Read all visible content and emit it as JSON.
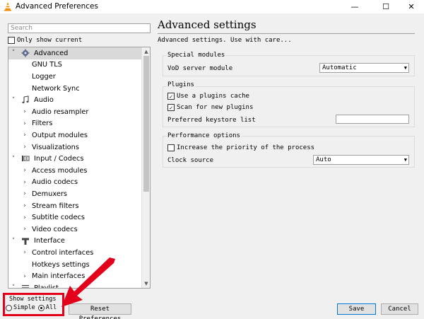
{
  "window": {
    "title": "Advanced Preferences",
    "minimize_glyph": "—",
    "maximize_glyph": "☐",
    "close_glyph": "✕"
  },
  "left": {
    "search_placeholder": "Search",
    "only_show_current": "Only show current",
    "tree": [
      {
        "label": "Advanced",
        "level": 0,
        "expanded": true,
        "icon": "gear-icon",
        "selected": true
      },
      {
        "label": "GNU TLS",
        "level": 1
      },
      {
        "label": "Logger",
        "level": 1
      },
      {
        "label": "Network Sync",
        "level": 1
      },
      {
        "label": "Audio",
        "level": 0,
        "expanded": true,
        "icon": "music-note-icon"
      },
      {
        "label": "Audio resampler",
        "level": 1,
        "has_children": true
      },
      {
        "label": "Filters",
        "level": 1,
        "has_children": true
      },
      {
        "label": "Output modules",
        "level": 1,
        "has_children": true
      },
      {
        "label": "Visualizations",
        "level": 1,
        "has_children": true
      },
      {
        "label": "Input / Codecs",
        "level": 0,
        "expanded": true,
        "icon": "codec-icon"
      },
      {
        "label": "Access modules",
        "level": 1,
        "has_children": true
      },
      {
        "label": "Audio codecs",
        "level": 1,
        "has_children": true
      },
      {
        "label": "Demuxers",
        "level": 1,
        "has_children": true
      },
      {
        "label": "Stream filters",
        "level": 1,
        "has_children": true
      },
      {
        "label": "Subtitle codecs",
        "level": 1,
        "has_children": true
      },
      {
        "label": "Video codecs",
        "level": 1,
        "has_children": true
      },
      {
        "label": "Interface",
        "level": 0,
        "expanded": true,
        "icon": "interface-icon"
      },
      {
        "label": "Control interfaces",
        "level": 1,
        "has_children": true
      },
      {
        "label": "Hotkeys settings",
        "level": 1
      },
      {
        "label": "Main interfaces",
        "level": 1,
        "has_children": true
      },
      {
        "label": "Playlist",
        "level": 0,
        "expanded": true,
        "icon": "playlist-icon"
      }
    ],
    "show_settings": {
      "label": "Show settings",
      "simple": "Simple",
      "all": "All",
      "selected": "All"
    },
    "reset_button": "Reset Preferences"
  },
  "right": {
    "title": "Advanced settings",
    "description": "Advanced settings. Use with care...",
    "groups": {
      "special": {
        "title": "Special modules",
        "vod_label": "VoD server module",
        "vod_value": "Automatic"
      },
      "plugins": {
        "title": "Plugins",
        "use_cache": "Use a plugins cache",
        "use_cache_checked": true,
        "scan_new": "Scan for new plugins",
        "scan_new_checked": true,
        "keystore_label": "Preferred keystore list",
        "keystore_value": ""
      },
      "performance": {
        "title": "Performance options",
        "increase_priority": "Increase the priority of the process",
        "increase_priority_checked": false,
        "clock_label": "Clock source",
        "clock_value": "Auto"
      }
    }
  },
  "footer": {
    "save": "Save",
    "cancel": "Cancel"
  },
  "annotation_color": "#e2001a"
}
